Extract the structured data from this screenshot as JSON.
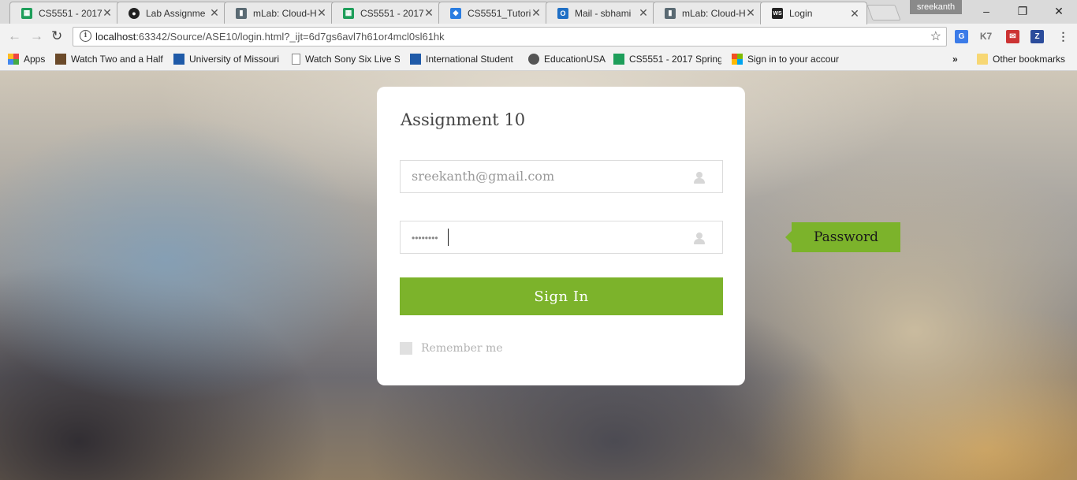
{
  "browser": {
    "tabs": [
      {
        "title": "CS5551 - 2017",
        "icon": "sheets-icon",
        "color": "#1e9e5a"
      },
      {
        "title": "Lab Assignme",
        "icon": "github-icon",
        "color": "#222222"
      },
      {
        "title": "mLab: Cloud-H",
        "icon": "mlab-icon",
        "color": "#5a6a73"
      },
      {
        "title": "CS5551 - 2017",
        "icon": "sheets-icon",
        "color": "#1e9e5a"
      },
      {
        "title": "CS5551_Tutori",
        "icon": "dropbox-icon",
        "color": "#2a7de1"
      },
      {
        "title": "Mail - sbhami",
        "icon": "outlook-icon",
        "color": "#1f6fc5"
      },
      {
        "title": "mLab: Cloud-H",
        "icon": "mlab-icon",
        "color": "#5a6a73"
      },
      {
        "title": "Login",
        "icon": "webstorm-icon",
        "color": "#222222"
      }
    ],
    "tab_close_glyph": "✕",
    "profile_name": "sreekanth",
    "url_host": "localhost",
    "url_rest": ":63342/Source/ASE10/login.html?_ijt=6d7gs6avl7h61or4mcl0sl61hk",
    "bookmarks": [
      {
        "label": "Apps",
        "icon": "apps-grid-icon"
      },
      {
        "label": "Watch Two and a Half",
        "icon": "film-icon"
      },
      {
        "label": "University of Missouri",
        "icon": "umkc-icon"
      },
      {
        "label": "Watch Sony Six Live S",
        "icon": "page-icon"
      },
      {
        "label": "International Student",
        "icon": "umkc-icon"
      },
      {
        "label": "EducationUSA",
        "icon": "seal-icon"
      },
      {
        "label": "CS5551 - 2017 Spring",
        "icon": "sheets-icon"
      },
      {
        "label": "Sign in to your accour",
        "icon": "microsoft-icon"
      }
    ],
    "overflow_label": "»",
    "other_bookmarks": "Other bookmarks"
  },
  "login": {
    "title": "Assignment 10",
    "email_value": "sreekanth@gmail.com",
    "password_mask": "••••••••",
    "signin_label": "Sign In",
    "remember_label": "Remember me",
    "tooltip": "Password",
    "accent": "#7cb32b"
  }
}
